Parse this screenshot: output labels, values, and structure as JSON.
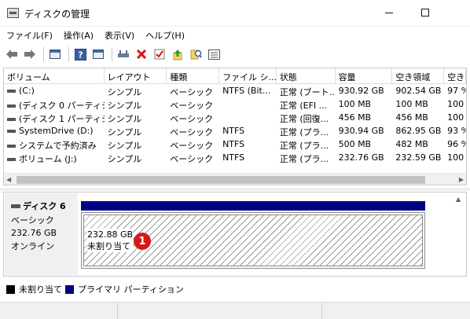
{
  "window": {
    "title": "ディスクの管理"
  },
  "menu": [
    "ファイル(F)",
    "操作(A)",
    "表示(V)",
    "ヘルプ(H)"
  ],
  "toolbar": {
    "icons": [
      "back-arrow-icon",
      "forward-arrow-icon",
      "properties-icon",
      "help-icon",
      "console-icon",
      "connect-drive-icon",
      "delete-icon",
      "check-icon",
      "up-arrow-icon",
      "search-icon",
      "list-icon"
    ]
  },
  "volumes": {
    "columns": [
      "ボリューム",
      "レイアウト",
      "種類",
      "ファイル シ...",
      "状態",
      "容量",
      "空き領域",
      "空き"
    ],
    "rows": [
      [
        "(C:)",
        "シンプル",
        "ベーシック",
        "NTFS (Bit...",
        "正常 (ブート...",
        "930.92 GB",
        "902.54 GB",
        "97 %"
      ],
      [
        "(ディスク 0 パーティシ...",
        "シンプル",
        "ベーシック",
        "",
        "正常 (EFI ...",
        "100 MB",
        "100 MB",
        "100"
      ],
      [
        "(ディスク 1 パーティシ...",
        "シンプル",
        "ベーシック",
        "",
        "正常 (回復...",
        "456 MB",
        "456 MB",
        "100"
      ],
      [
        "SystemDrive (D:)",
        "シンプル",
        "ベーシック",
        "NTFS",
        "正常 (プラ...",
        "930.94 GB",
        "862.95 GB",
        "93 %"
      ],
      [
        "システムで予約済み",
        "シンプル",
        "ベーシック",
        "NTFS",
        "正常 (プラ...",
        "500 MB",
        "482 MB",
        "96 %"
      ],
      [
        "ボリューム (J:)",
        "シンプル",
        "ベーシック",
        "NTFS",
        "正常 (プラ...",
        "232.76 GB",
        "232.59 GB",
        "100"
      ]
    ]
  },
  "disk": {
    "name": "ディスク 6",
    "type": "ベーシック",
    "size": "232.76 GB",
    "status": "オンライン",
    "partition": {
      "size": "232.88 GB",
      "label": "未割り当て",
      "badge": "1"
    }
  },
  "legend": {
    "items": [
      {
        "label": "未割り当て",
        "color": "#000000"
      },
      {
        "label": "プライマリ パーティション",
        "color": "#000082"
      }
    ]
  }
}
